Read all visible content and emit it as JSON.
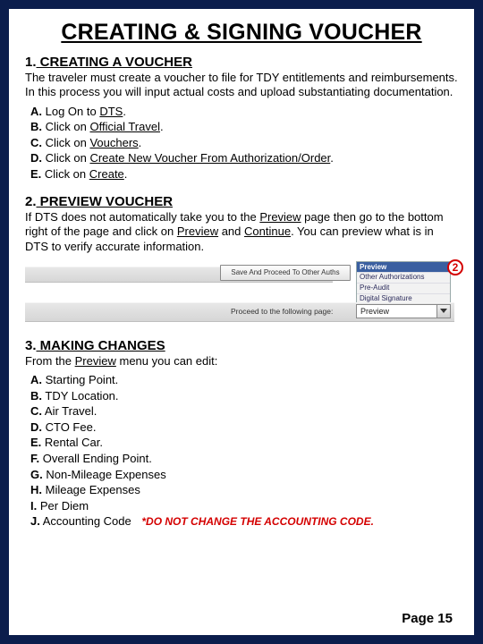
{
  "title": "CREATING & SIGNING VOUCHER",
  "s1": {
    "num": "1.",
    "head": " CREATING A VOUCHER",
    "para": "The traveler must create a voucher to file for TDY entitlements and reimbursements.  In this process you will input actual costs and upload substantiating documentation.",
    "steps": {
      "a": {
        "l": "A.",
        "pre": " Log On to ",
        "u": "DTS",
        "post": "."
      },
      "b": {
        "l": "B.",
        "pre": " Click on ",
        "u": "Official Travel",
        "post": "."
      },
      "c": {
        "l": "C.",
        "pre": " Click on ",
        "u": "Vouchers",
        "post": "."
      },
      "d": {
        "l": "D.",
        "pre": " Click on ",
        "u": "Create New Voucher From Authorization/Order",
        "post": "."
      },
      "e": {
        "l": "E.",
        "pre": " Click on ",
        "u": "Create",
        "post": "."
      }
    }
  },
  "s2": {
    "num": "2.",
    "head": " PREVIEW VOUCHER",
    "pre": "If DTS does not automatically take you to the ",
    "u1": "Preview",
    "mid1": " page then go to the bottom right of the page and click on ",
    "u2": "Preview",
    "mid2": " and ",
    "u3": "Continue",
    "post": ".   You can preview what is in DTS to verify accurate information."
  },
  "ui": {
    "saveBtn": "Save And Proceed To Other Auths",
    "proceed": "Proceed to the following page:",
    "dropdown": "Preview",
    "panelHeader": "Preview",
    "panelRows": [
      "Other Authorizations",
      "Pre-Audit",
      "Digital Signature"
    ],
    "callout": "2"
  },
  "s3": {
    "num": "3.",
    "head": " MAKING CHANGES",
    "intro_pre": "From  the ",
    "intro_u": "Preview",
    "intro_post": " menu you can edit:",
    "items": {
      "a": {
        "l": "A.",
        "t": " Starting Point."
      },
      "b": {
        "l": "B.",
        "t": " TDY Location."
      },
      "c": {
        "l": "C.",
        "t": " Air Travel."
      },
      "d": {
        "l": "D.",
        "t": " CTO Fee."
      },
      "e": {
        "l": "E.",
        "t": " Rental Car."
      },
      "f": {
        "l": "F.",
        "t": " Overall Ending Point."
      },
      "g": {
        "l": "G.",
        "t": " Non-Mileage Expenses"
      },
      "h": {
        "l": "H.",
        "t": " Mileage Expenses"
      },
      "i": {
        "l": " I.",
        "t": " Per Diem"
      },
      "j": {
        "l": "J.",
        "t": " Accounting Code",
        "warn": "*DO NOT CHANGE THE ACCOUNTING CODE."
      }
    }
  },
  "footer": "Page 15"
}
